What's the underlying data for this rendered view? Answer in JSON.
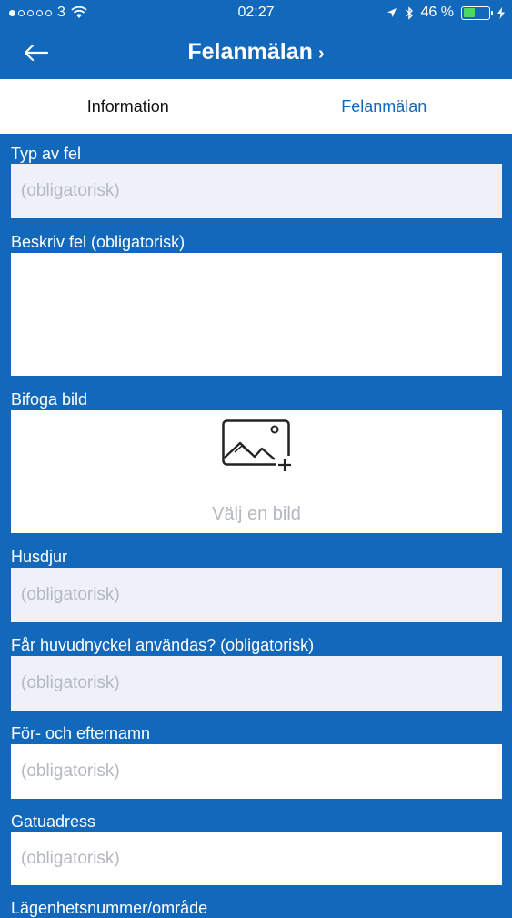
{
  "status": {
    "carrier": "3",
    "time": "02:27",
    "battery": "46 %",
    "battery_level": 0.46
  },
  "nav": {
    "title": "Felanmälan",
    "title_chevron": "›",
    "back_icon": "arrow-left-icon"
  },
  "tabs": [
    {
      "label": "Information",
      "active": false
    },
    {
      "label": "Felanmälan",
      "active": true
    }
  ],
  "form": {
    "type": {
      "label": "Typ av fel",
      "placeholder": "(obligatorisk)"
    },
    "describe": {
      "label": "Beskriv fel (obligatorisk)",
      "value": ""
    },
    "attach": {
      "label": "Bifoga bild",
      "button": "Välj en bild",
      "icon": "add-image-icon"
    },
    "pets": {
      "label": "Husdjur",
      "placeholder": "(obligatorisk)"
    },
    "masterkey": {
      "label": "Får huvudnyckel användas? (obligatorisk)",
      "placeholder": "(obligatorisk)"
    },
    "name": {
      "label": "För- och efternamn",
      "placeholder": "(obligatorisk)"
    },
    "street": {
      "label": "Gatuadress",
      "placeholder": "(obligatorisk)"
    },
    "apartment": {
      "label": "Lägenhetsnummer/område"
    }
  },
  "colors": {
    "brand": "#1268bb",
    "field_bg": "#eef2f8",
    "placeholder": "#b4b8bf",
    "battery": "#4cd964"
  }
}
